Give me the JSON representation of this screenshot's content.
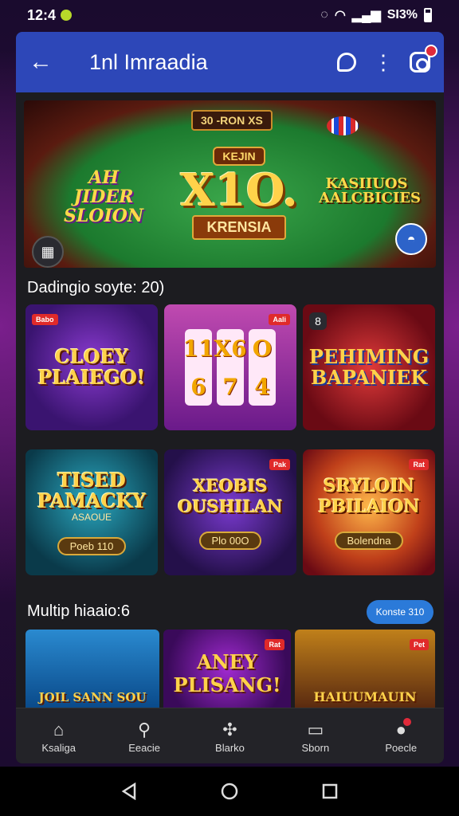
{
  "status_bar": {
    "time": "12:4",
    "signal_text": "SI3%"
  },
  "app_bar": {
    "title": "1nl Imraadia"
  },
  "hero": {
    "top_tag": "30 -RON XS",
    "small_label": "KEJIN",
    "big_text": "X1O.",
    "sub_label": "KRENSIA",
    "left_text": "AH JIDER SLOION",
    "right_text": "KASIIUOS AALCBICIES"
  },
  "section1": {
    "title": "Dadingio soyte: 20)"
  },
  "games_row1": [
    {
      "title": "CLOEY PLAIEGO!",
      "badge": "Babo"
    },
    {
      "reels": [
        "11",
        "X6",
        "O"
      ],
      "reels2": [
        "6",
        "7",
        "4"
      ],
      "badge": "Aali"
    },
    {
      "title": "PEHIMING BAPANIEK",
      "corner": "8"
    }
  ],
  "games_row2": [
    {
      "title": "TISED PAMACKY",
      "subtitle": "ASAOUE",
      "pill": "Poeb 110"
    },
    {
      "title": "XEOBIS OUSHILAN",
      "pill": "Plo 00O",
      "badge": "Pak"
    },
    {
      "title": "SRYLOIN PBILAION",
      "pill": "Bolendna",
      "badge": "Rat"
    }
  ],
  "section2": {
    "title": "Multip hiaaio:6",
    "button": "Konste 310"
  },
  "strip": [
    {
      "text": "JOIL SANN SOU"
    },
    {
      "text": "ANEY PLISANG!",
      "badge": "Rat"
    },
    {
      "text": "HAIUUMAUIN",
      "badge": "Pet"
    }
  ],
  "bottom_nav": [
    {
      "label": "Ksaliga",
      "icon": "home-icon"
    },
    {
      "label": "Eeacie",
      "icon": "search-icon"
    },
    {
      "label": "Blarko",
      "icon": "grid-icon"
    },
    {
      "label": "Sborn",
      "icon": "document-icon"
    },
    {
      "label": "Poecle",
      "icon": "person-icon"
    }
  ]
}
